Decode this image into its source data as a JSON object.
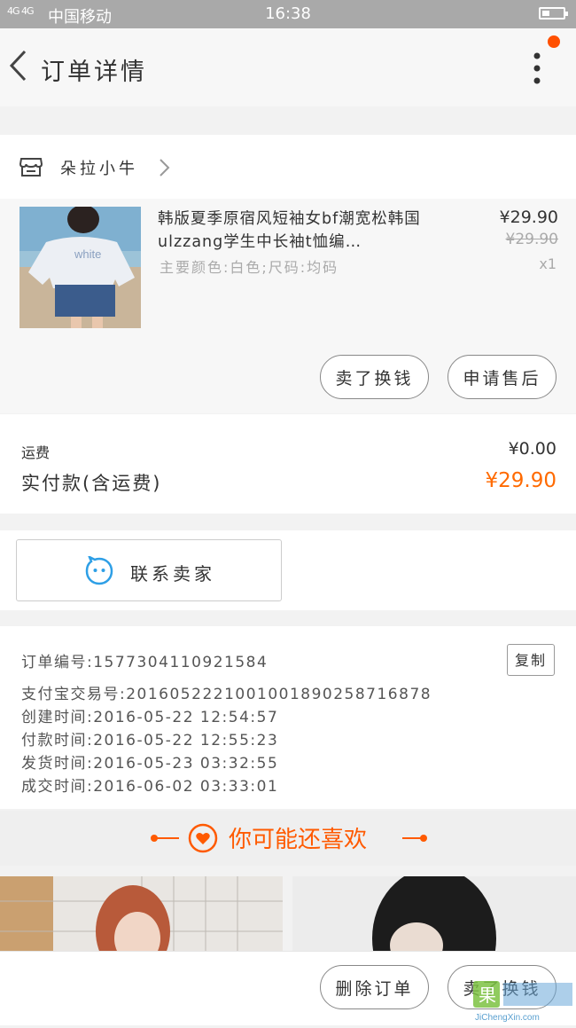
{
  "status_bar": {
    "signal": "4G 4G",
    "carrier": "中国移动",
    "time": "16:38"
  },
  "header": {
    "title": "订单详情"
  },
  "shop": {
    "name": "朵拉小牛"
  },
  "product": {
    "title": "韩版夏季原宿风短袖女bf潮宽松韩国ulzzang学生中长袖t恤编…",
    "spec": "主要颜色:白色;尺码:均码",
    "price": "¥29.90",
    "original_price": "¥29.90",
    "quantity": "x1",
    "image_text": "white"
  },
  "product_actions": {
    "sell_exchange": "卖了换钱",
    "after_sale": "申请售后"
  },
  "amounts": {
    "shipping_label": "运费",
    "shipping_value": "¥0.00",
    "paid_label": "实付款(含运费)",
    "paid_value": "¥29.90"
  },
  "contact": {
    "label": "联系卖家"
  },
  "order_info": {
    "order_no": "订单编号:1577304110921584",
    "alipay_no": "支付宝交易号:2016052221001001890258716878",
    "created": "创建时间:2016-05-22 12:54:57",
    "paid": "付款时间:2016-05-22 12:55:23",
    "shipped": "发货时间:2016-05-23 03:32:55",
    "completed": "成交时间:2016-06-02 03:33:01",
    "copy_label": "复制"
  },
  "recommend": {
    "title": "你可能还喜欢"
  },
  "bottom_bar": {
    "delete_order": "删除订单",
    "sell_exchange": "卖了换钱"
  },
  "watermark": {
    "brand": "果",
    "domain": "JiChengXin.com"
  },
  "colors": {
    "accent": "#ff5a00",
    "price_orange": "#ff6a00",
    "status_bar": "#a9a9a9"
  }
}
